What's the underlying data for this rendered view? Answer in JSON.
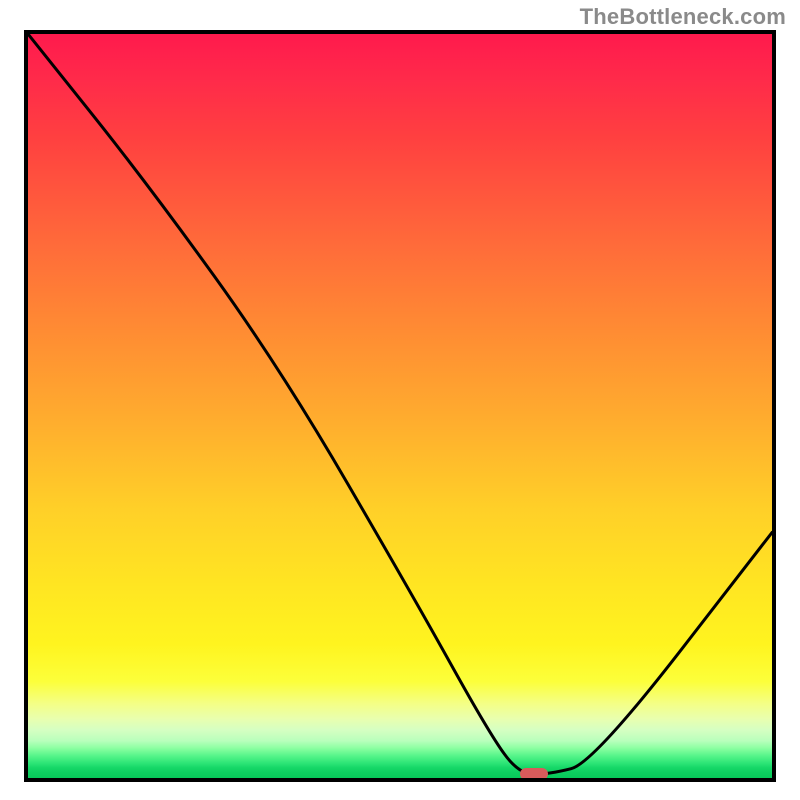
{
  "watermark_text": "TheBottleneck.com",
  "chart_data": {
    "type": "line",
    "title": "",
    "xlabel": "",
    "ylabel": "",
    "xlim": [
      0,
      100
    ],
    "ylim": [
      0,
      100
    ],
    "grid": false,
    "legend": false,
    "series": [
      {
        "name": "curve",
        "x": [
          0,
          16,
          34,
          52,
          62,
          66,
          70,
          76,
          100
        ],
        "values": [
          100,
          80,
          55,
          24,
          6,
          0.5,
          0.5,
          2,
          33
        ]
      }
    ],
    "marker": {
      "x": 68,
      "y": 0.5
    },
    "background_gradient": {
      "top": "#ff1a4d",
      "mid": "#ffe522",
      "bottom": "#07c95a"
    }
  }
}
